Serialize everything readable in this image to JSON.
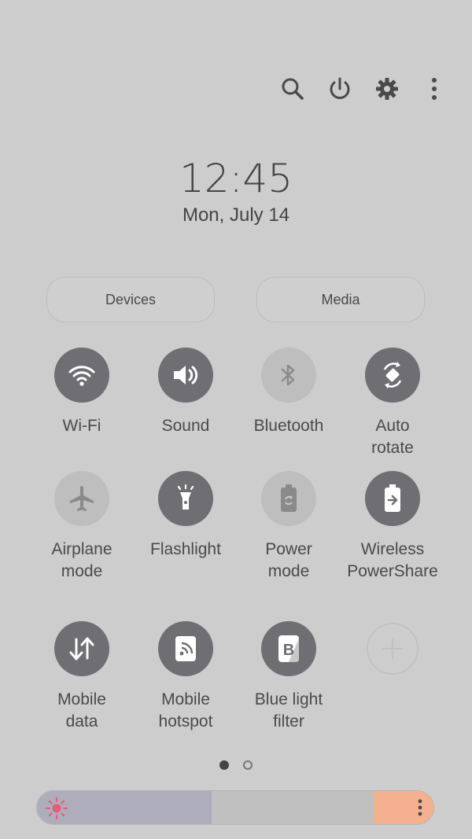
{
  "time": "12:45",
  "date": "Mon, July 14",
  "pills": {
    "devices": "Devices",
    "media": "Media"
  },
  "topbar_icons": [
    "search-icon",
    "power-icon",
    "gear-icon",
    "more-vertical-icon"
  ],
  "tiles": [
    {
      "label": "Wi-Fi",
      "icon": "wifi-icon",
      "state": "on"
    },
    {
      "label": "Sound",
      "icon": "volume-icon",
      "state": "on"
    },
    {
      "label": "Bluetooth",
      "icon": "bluetooth-icon",
      "state": "off"
    },
    {
      "label": "Auto\nrotate",
      "icon": "auto-rotate-icon",
      "state": "on"
    },
    {
      "label": "Airplane\nmode",
      "icon": "airplane-icon",
      "state": "off"
    },
    {
      "label": "Flashlight",
      "icon": "flashlight-icon",
      "state": "on"
    },
    {
      "label": "Power\nmode",
      "icon": "battery-icon",
      "state": "off"
    },
    {
      "label": "Wireless\nPowerShare",
      "icon": "power-share-icon",
      "state": "on"
    },
    {
      "label": "Mobile\ndata",
      "icon": "data-arrows-icon",
      "state": "on"
    },
    {
      "label": "Mobile\nhotspot",
      "icon": "hotspot-icon",
      "state": "on"
    },
    {
      "label": "Blue light\nfilter",
      "icon": "blue-light-icon",
      "state": "on"
    },
    {
      "label": "",
      "icon": "plus-icon",
      "state": "add"
    }
  ],
  "page_indicator": {
    "current": 1,
    "total": 2
  },
  "brightness": {
    "level": 0.44,
    "colors": {
      "fill": "#adadbb",
      "more": "#f5b08f",
      "sun": "#e85a7a"
    }
  }
}
